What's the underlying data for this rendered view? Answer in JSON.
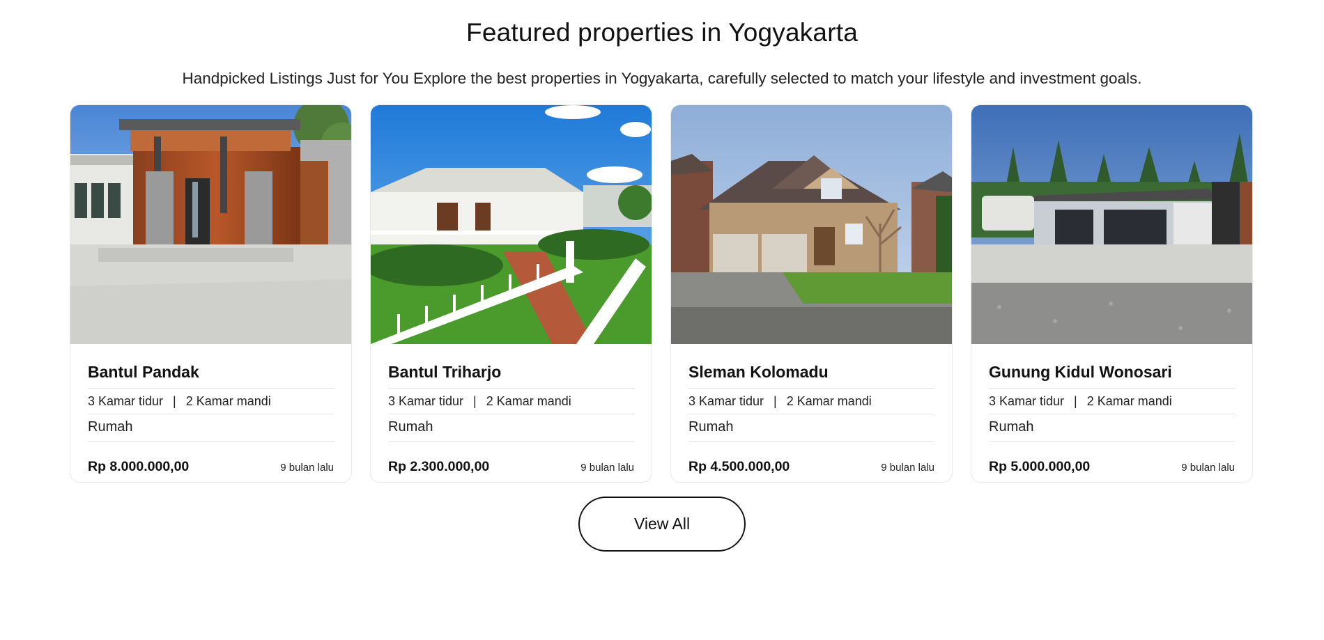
{
  "section": {
    "title": "Featured properties in Yogyakarta",
    "subtitle": "Handpicked Listings Just for You Explore the best properties in Yogyakarta, carefully selected to match your lifestyle and investment goals.",
    "view_all_label": "View All"
  },
  "listings": [
    {
      "name": "Bantul Pandak",
      "bedrooms": "3 Kamar tidur",
      "divider": "|",
      "bathrooms": "2 Kamar mandi",
      "type": "Rumah",
      "price": "Rp 8.000.000,00",
      "posted": "9 bulan lalu",
      "photo_icon": "modern-wood-house-photo"
    },
    {
      "name": "Bantul Triharjo",
      "bedrooms": "3 Kamar tidur",
      "divider": "|",
      "bathrooms": "2 Kamar mandi",
      "type": "Rumah",
      "price": "Rp 2.300.000,00",
      "posted": "9 bulan lalu",
      "photo_icon": "white-veranda-house-photo"
    },
    {
      "name": "Sleman Kolomadu",
      "bedrooms": "3 Kamar tidur",
      "divider": "|",
      "bathrooms": "2 Kamar mandi",
      "type": "Rumah",
      "price": "Rp 4.500.000,00",
      "posted": "9 bulan lalu",
      "photo_icon": "brick-suburban-house-photo"
    },
    {
      "name": "Gunung Kidul Wonosari",
      "bedrooms": "3 Kamar tidur",
      "divider": "|",
      "bathrooms": "2 Kamar mandi",
      "type": "Rumah",
      "price": "Rp 5.000.000,00",
      "posted": "9 bulan lalu",
      "photo_icon": "garage-house-photo"
    }
  ]
}
